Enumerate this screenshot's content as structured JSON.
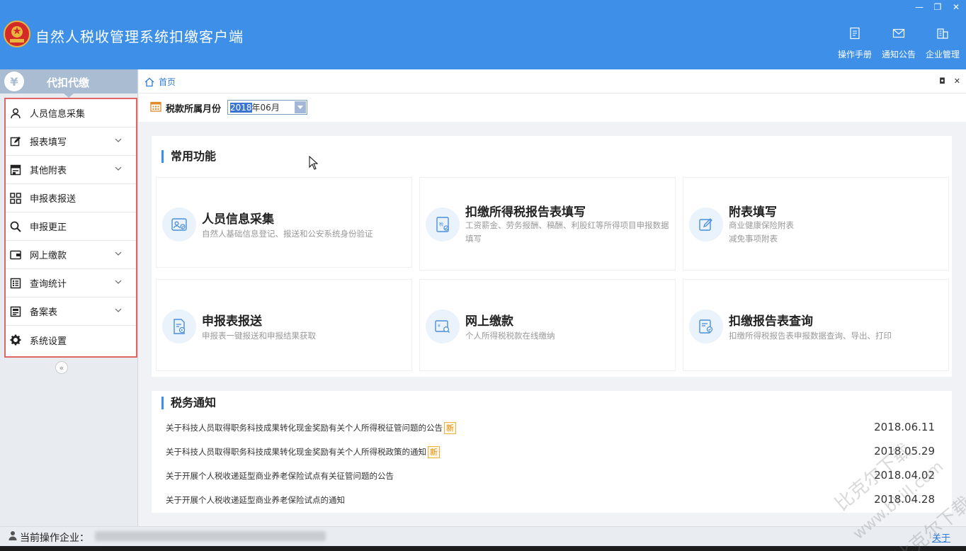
{
  "header": {
    "title": "自然人税收管理系统扣缴客户端",
    "tools": [
      {
        "label": "操作手册",
        "icon": "manual-icon"
      },
      {
        "label": "通知公告",
        "icon": "mail-icon"
      },
      {
        "label": "企业管理",
        "icon": "building-icon"
      }
    ],
    "window_controls": {
      "minimize": "—",
      "restore": "❐",
      "close": "✕"
    }
  },
  "sidebar": {
    "title": "代扣代缴",
    "yen": "¥",
    "items": [
      {
        "label": "人员信息采集",
        "expandable": false
      },
      {
        "label": "报表填写",
        "expandable": true
      },
      {
        "label": "其他附表",
        "expandable": true
      },
      {
        "label": "申报表报送",
        "expandable": false
      },
      {
        "label": "申报更正",
        "expandable": false
      },
      {
        "label": "网上缴款",
        "expandable": true
      },
      {
        "label": "查询统计",
        "expandable": true
      },
      {
        "label": "备案表",
        "expandable": true
      },
      {
        "label": "系统设置",
        "expandable": false
      }
    ],
    "collapse": "«"
  },
  "tabbar": {
    "home_label": "首页"
  },
  "month": {
    "label": "税款所属月份",
    "year": "2018",
    "rest": "年06月"
  },
  "functions": {
    "title": "常用功能",
    "cards": [
      {
        "title": "人员信息采集",
        "desc": "自然人基础信息登记、报送和公安系统身份验证"
      },
      {
        "title": "扣缴所得税报告表填写",
        "desc": "工资薪金、劳务报酬、稿酬、利股红等所得项目申报数据填写"
      },
      {
        "title": "附表填写",
        "desc": "商业健康保险附表",
        "desc2": "减免事项附表"
      },
      {
        "title": "申报表报送",
        "desc": "申报表一键报送和申报结果获取"
      },
      {
        "title": "网上缴款",
        "desc": "个人所得税税款在线缴纳"
      },
      {
        "title": "扣缴报告表查询",
        "desc": "扣缴所得税报告表申报数据查询、导出、打印"
      }
    ]
  },
  "notices": {
    "title": "税务通知",
    "items": [
      {
        "text": "关于科技人员取得职务科技成果转化现金奖励有关个人所得税征管问题的公告",
        "badge": "新",
        "date": "2018.06.11"
      },
      {
        "text": "关于科技人员取得职务科技成果转化现金奖励有关个人所得税政策的通知",
        "badge": "新",
        "date": "2018.05.29"
      },
      {
        "text": "关于开展个人税收递延型商业养老保险试点有关征管问题的公告",
        "badge": "",
        "date": "2018.04.02"
      },
      {
        "text": "关于开展个人税收递延型商业养老保险试点的通知",
        "badge": "",
        "date": "2018.04.28"
      }
    ]
  },
  "footer": {
    "label": "当前操作企业：",
    "about": "关于"
  },
  "watermark": {
    "text1": "比克尔下载",
    "text2": "www.bkill.com",
    "text3": "比克尔下载"
  },
  "colors": {
    "header": "#3d8fe8",
    "accent": "#2f7bd6",
    "highlight": "#e06666"
  }
}
